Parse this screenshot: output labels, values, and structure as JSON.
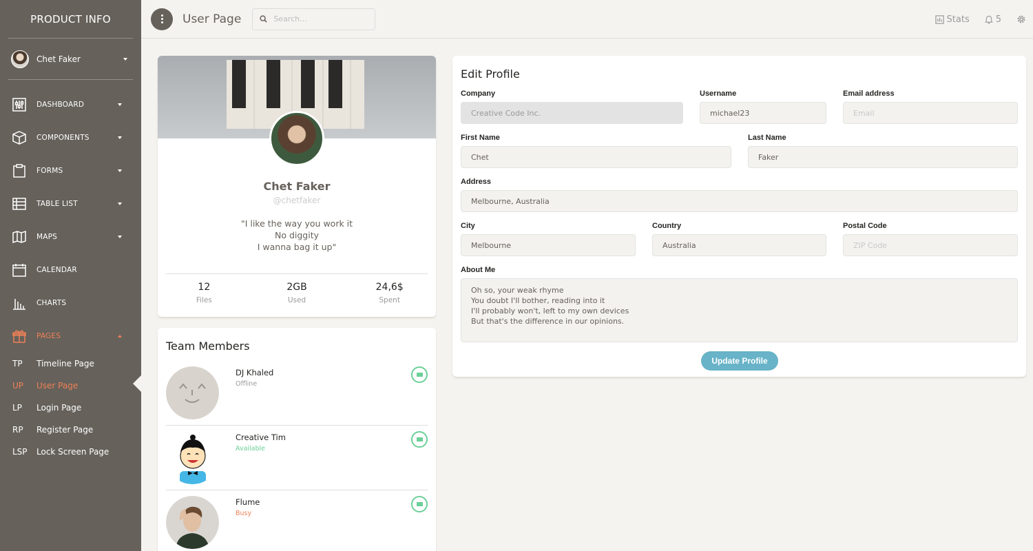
{
  "sidebar": {
    "brand": "PRODUCT INFO",
    "user_name": "Chet Faker",
    "nav": [
      {
        "label": "DASHBOARD",
        "icon": "dashboard-icon"
      },
      {
        "label": "COMPONENTS",
        "icon": "box-icon"
      },
      {
        "label": "FORMS",
        "icon": "clipboard-icon"
      },
      {
        "label": "TABLE LIST",
        "icon": "table-icon"
      },
      {
        "label": "MAPS",
        "icon": "map-icon"
      },
      {
        "label": "CALENDAR",
        "icon": "calendar-icon"
      },
      {
        "label": "CHARTS",
        "icon": "chart-icon"
      },
      {
        "label": "PAGES",
        "icon": "gift-icon"
      }
    ],
    "pages": [
      {
        "abbr": "TP",
        "label": "Timeline Page"
      },
      {
        "abbr": "UP",
        "label": "User Page"
      },
      {
        "abbr": "LP",
        "label": "Login Page"
      },
      {
        "abbr": "RP",
        "label": "Register Page"
      },
      {
        "abbr": "LSP",
        "label": "Lock Screen Page"
      }
    ]
  },
  "topbar": {
    "title": "User Page",
    "search_placeholder": "Search...",
    "stats_label": "Stats",
    "notifications_count": "5"
  },
  "profile": {
    "name": "Chet Faker",
    "handle": "@chetfaker",
    "quote_lines": [
      "\"I like the way you work it",
      "No diggity",
      "I wanna bag it up\""
    ],
    "stats": [
      {
        "value": "12",
        "label": "Files"
      },
      {
        "value": "2GB",
        "label": "Used"
      },
      {
        "value": "24,6$",
        "label": "Spent"
      }
    ]
  },
  "team": {
    "title": "Team Members",
    "members": [
      {
        "name": "DJ Khaled",
        "status": "Offline",
        "status_color": "#9a9a9a"
      },
      {
        "name": "Creative Tim",
        "status": "Available",
        "status_color": "#6bd098"
      },
      {
        "name": "Flume",
        "status": "Busy",
        "status_color": "#ef8157"
      }
    ]
  },
  "edit": {
    "title": "Edit Profile",
    "company_label": "Company",
    "company_value": "Creative Code Inc.",
    "username_label": "Username",
    "username_value": "michael23",
    "email_label": "Email address",
    "email_placeholder": "Email",
    "first_label": "First Name",
    "first_value": "Chet",
    "last_label": "Last Name",
    "last_value": "Faker",
    "address_label": "Address",
    "address_value": "Melbourne, Australia",
    "city_label": "City",
    "city_value": "Melbourne",
    "country_label": "Country",
    "country_value": "Australia",
    "postal_label": "Postal Code",
    "postal_placeholder": "ZIP Code",
    "about_label": "About Me",
    "about_value": "Oh so, your weak rhyme\nYou doubt I'll bother, reading into it\nI'll probably won't, left to my own devices\nBut that's the difference in our opinions.",
    "button_label": "Update Profile"
  },
  "colors": {
    "sidebar": "#66615b",
    "accent": "#ef8157",
    "primary_button": "#68b3c8",
    "success": "#6bd098"
  }
}
